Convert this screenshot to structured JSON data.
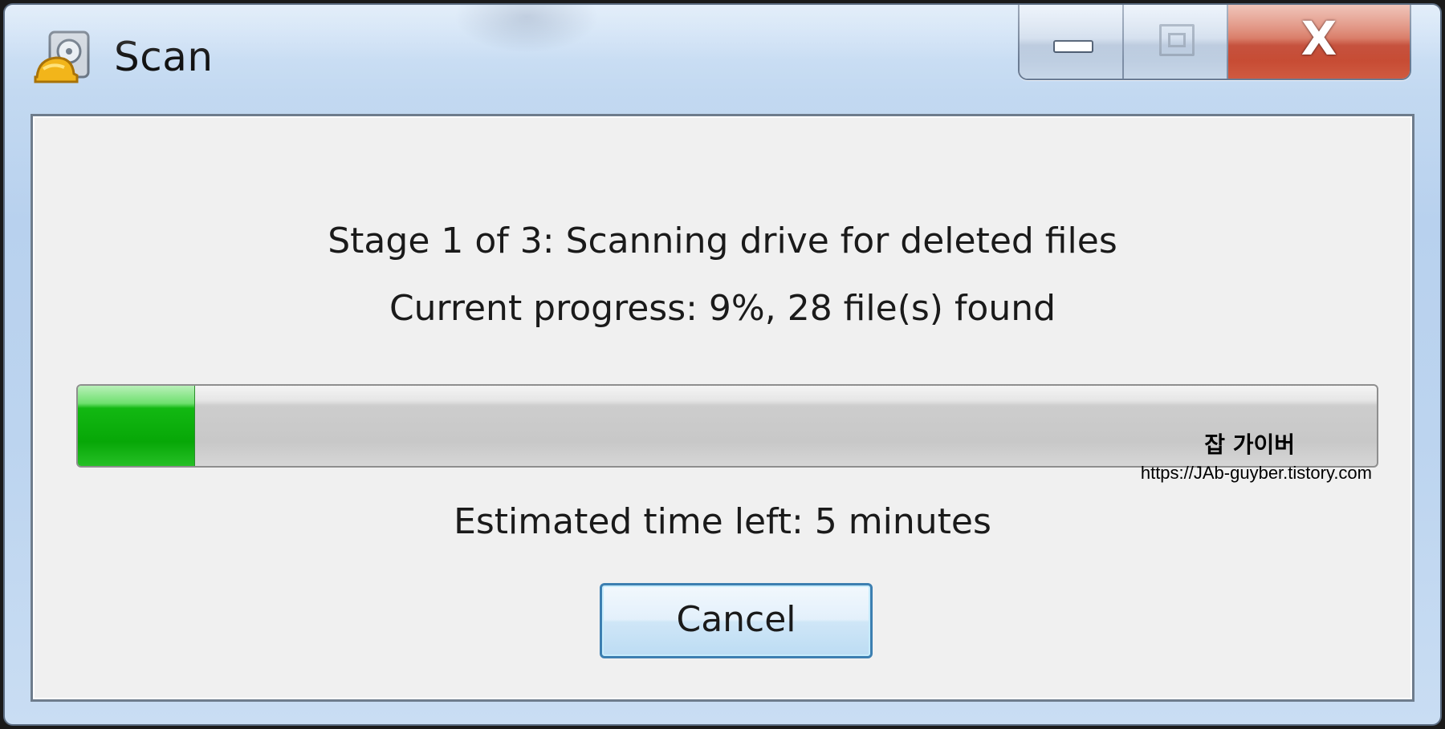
{
  "window": {
    "title": "Scan",
    "icon": "hard-drive-helmet-icon",
    "buttons": {
      "minimize_icon": "minimize-icon",
      "maximize_icon": "maximize-icon",
      "close_icon": "close-icon",
      "close_glyph": "X"
    }
  },
  "scan": {
    "stage_text": "Stage 1 of 3: Scanning drive for deleted files",
    "progress_text": "Current progress: 9%, 28 file(s) found",
    "progress_percent": 9,
    "eta_text": "Estimated time left: 5 minutes",
    "cancel_label": "Cancel"
  },
  "watermark": {
    "title": "잡 가이버",
    "url": "https://JAb-guyber.tistory.com"
  },
  "colors": {
    "progress_fill": "#07a707",
    "close_button": "#c0402a",
    "focus_border": "#3c7fb1"
  }
}
